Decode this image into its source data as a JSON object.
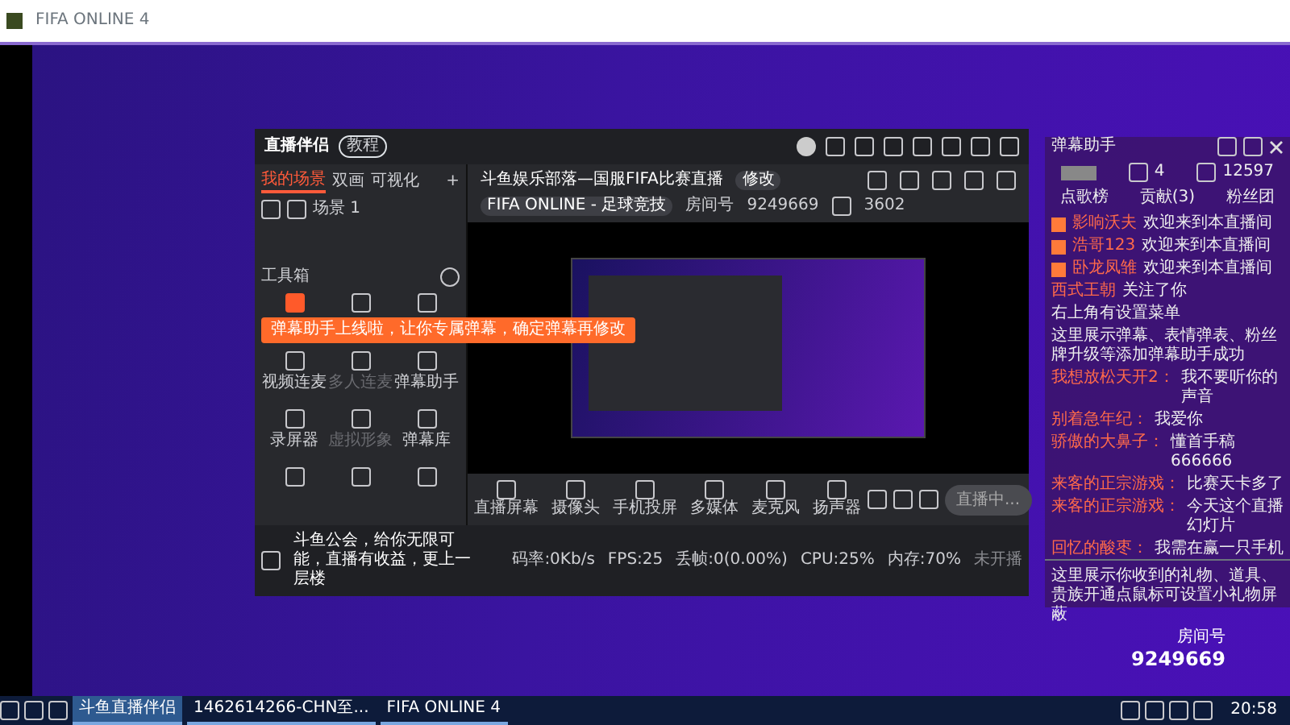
{
  "window": {
    "title": "FIFA ONLINE 4"
  },
  "app": {
    "logo": "直播伴侣",
    "guide_badge": "教程",
    "tabs": [
      {
        "label": "我的场景",
        "selected": true
      },
      {
        "label": "双画",
        "selected": false
      },
      {
        "label": "可视化",
        "selected": false
      }
    ],
    "add_scene": "+",
    "scene": "场景 1",
    "stream_title": "斗鱼娱乐部落—国服FIFA比赛直播",
    "edit_tag": "修改",
    "category": "FIFA ONLINE - 足球竞技",
    "room_label": "房间号",
    "room_id": "9249669",
    "popularity": "3602",
    "toolbox_title": "工具箱",
    "tools": [
      {
        "label": "视频连麦",
        "disabled": false
      },
      {
        "label": "多人连麦",
        "disabled": true
      },
      {
        "label": "弹幕助手",
        "disabled": false
      },
      {
        "label": "录屏器",
        "disabled": false
      },
      {
        "label": "虚拟形象",
        "disabled": true
      },
      {
        "label": "弹幕库",
        "disabled": false
      }
    ],
    "banner": "弹幕助手上线啦，让你专属弹幕，确定弹幕再修改",
    "media": [
      "直播屏幕",
      "摄像头",
      "手机投屏",
      "多媒体",
      "麦克风",
      "扬声器"
    ],
    "live_button": "直播中...",
    "notice": "斗鱼公会，给你无限可能，直播有收益，更上一层楼",
    "stats": [
      "码率:0Kb/s",
      "FPS:25",
      "丢帧:0(0.00%)",
      "CPU:25%",
      "内存:70%",
      "未开播"
    ]
  },
  "chat": {
    "title": "弹幕助手",
    "stats": [
      "4",
      "12597"
    ],
    "tabs": [
      "点歌榜",
      "贡献(3)",
      "粉丝团"
    ],
    "messages": [
      {
        "kind": "user",
        "badge": true,
        "name": "影响沃夫",
        "text": "欢迎来到本直播间"
      },
      {
        "kind": "user",
        "badge": true,
        "name": "浩哥123",
        "text": "欢迎来到本直播间"
      },
      {
        "kind": "user",
        "badge": true,
        "name": "卧龙凤雏",
        "text": "欢迎来到本直播间"
      },
      {
        "kind": "user",
        "badge": false,
        "name": "西式王朝",
        "text": "关注了你"
      },
      {
        "kind": "system",
        "text": "右上角有设置菜单"
      },
      {
        "kind": "system",
        "text": "这里展示弹幕、表情弹表、粉丝牌升级等添加弹幕助手成功"
      },
      {
        "kind": "user",
        "badge": false,
        "name": "我想放松天开2：",
        "text": "我不要听你的声音"
      },
      {
        "kind": "user",
        "badge": false,
        "name": "别着急年纪：",
        "text": "我爱你"
      },
      {
        "kind": "user",
        "badge": false,
        "name": "骄傲的大鼻子：",
        "text": "懂首手稿666666"
      },
      {
        "kind": "user",
        "badge": false,
        "name": "来客的正宗游戏：",
        "text": "比赛天卡多了"
      },
      {
        "kind": "user",
        "badge": false,
        "name": "来客的正宗游戏：",
        "text": "今天这个直播幻灯片"
      },
      {
        "kind": "user",
        "badge": false,
        "name": "回忆的酸枣：",
        "text": "我需在赢一只手机"
      }
    ],
    "footer": "这里展示你收到的礼物、道具、贵族开通点鼠标可设置小礼物屏蔽"
  },
  "watermark_room": {
    "label": "房间号",
    "number": "9249669"
  },
  "taskbar": {
    "items": [
      {
        "label": "斗鱼直播伴侣",
        "selected": true
      },
      {
        "label": "1462614266-CHN至...",
        "selected": false
      },
      {
        "label": "FIFA ONLINE 4",
        "selected": false
      }
    ],
    "clock": "20:58"
  }
}
